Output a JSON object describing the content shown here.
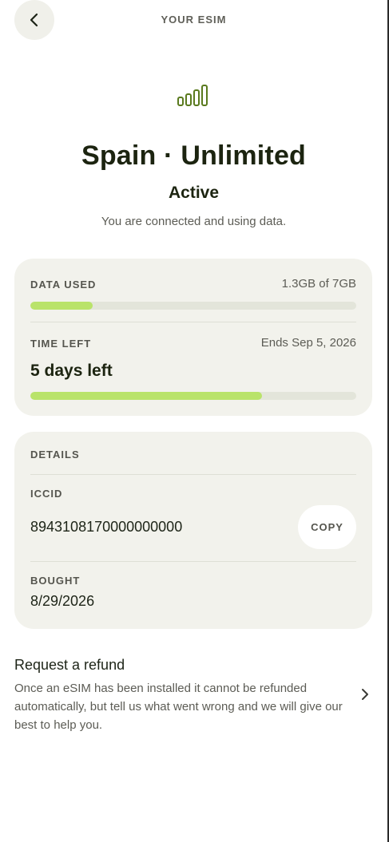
{
  "header": {
    "title": "YOUR ESIM",
    "back_icon": "chevron-left-icon"
  },
  "plan": {
    "signal_icon": "signal-bars-icon",
    "title": "Spain · Unlimited",
    "status": "Active",
    "status_message": "You are connected and using data."
  },
  "usage": {
    "data_used_label": "DATA USED",
    "data_used_value": "1.3GB of 7GB",
    "data_used_fraction": 0.19,
    "time_left_label": "TIME LEFT",
    "time_left_end": "Ends Sep 5, 2026",
    "time_left_text": "5 days left",
    "time_left_fraction": 0.71
  },
  "details": {
    "section_label": "DETAILS",
    "iccid_label": "ICCID",
    "iccid_value": "8943108170000000000",
    "copy_label": "COPY",
    "bought_label": "BOUGHT",
    "bought_value": "8/29/2026"
  },
  "refund": {
    "title": "Request a refund",
    "body": "Once an eSIM has been installed it cannot be refunded automatically, but tell us what went wrong and we will give our best to help you.",
    "chevron_icon": "chevron-right-icon"
  },
  "colors": {
    "accent": "#b9e36a",
    "card_bg": "#f2f2ec",
    "track": "#e3e5da",
    "signal": "#5a7a1e"
  }
}
